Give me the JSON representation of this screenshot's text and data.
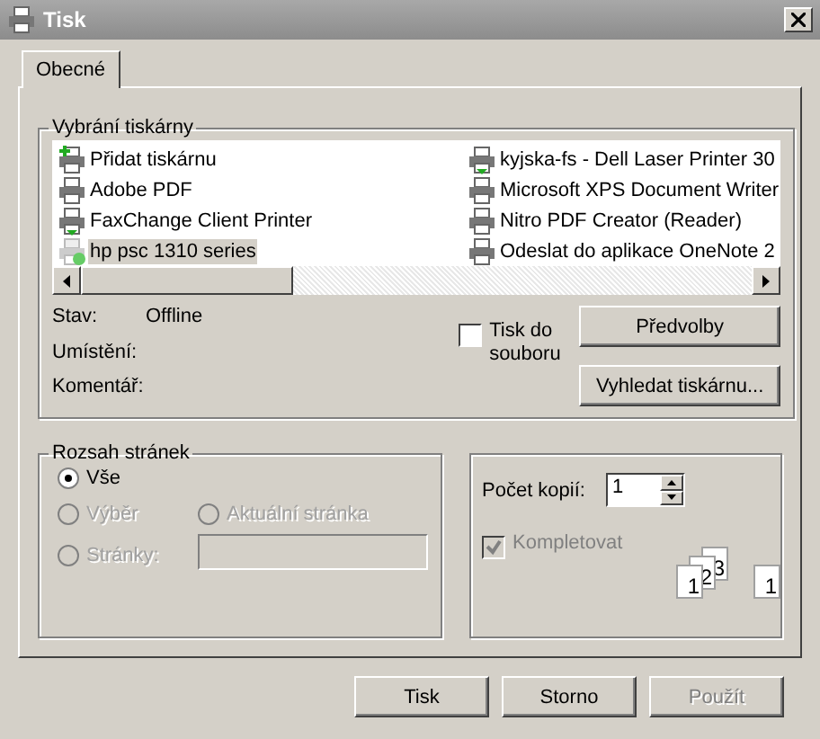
{
  "window": {
    "title": "Tisk"
  },
  "tabs": [
    {
      "label": "Obecné",
      "selected": true
    }
  ],
  "printer_group": {
    "title": "Vybrání tiskárny",
    "printers": [
      {
        "name": "Přidat tiskárnu",
        "kind": "add",
        "selected": false
      },
      {
        "name": "Adobe PDF",
        "kind": "printer",
        "selected": false
      },
      {
        "name": "FaxChange Client Printer",
        "kind": "network",
        "selected": false
      },
      {
        "name": "hp psc 1310 series",
        "kind": "default",
        "selected": true
      },
      {
        "name": "kyjska-fs - Dell Laser Printer 30",
        "kind": "network",
        "selected": false
      },
      {
        "name": "Microsoft XPS Document Writer",
        "kind": "printer",
        "selected": false
      },
      {
        "name": "Nitro PDF Creator (Reader)",
        "kind": "printer",
        "selected": false
      },
      {
        "name": "Odeslat do aplikace OneNote 2",
        "kind": "printer",
        "selected": false
      }
    ],
    "info": [
      {
        "label": "Stav:",
        "value": "Offline"
      },
      {
        "label": "Umístění:"
      },
      {
        "label": "Komentář:"
      }
    ],
    "print_to_file": {
      "label": "Tisk do souboru",
      "checked": false
    },
    "buttons": [
      "Předvolby",
      "Vyhledat tiskárnu..."
    ]
  },
  "range_group": {
    "title": "Rozsah stránek",
    "options": [
      {
        "label": "Vše",
        "selected": true,
        "disabled": false
      },
      {
        "label": "Výběr",
        "selected": false,
        "disabled": true
      },
      {
        "label": "Aktuální stránka",
        "selected": false,
        "disabled": true
      },
      {
        "label": "Stránky:",
        "selected": false,
        "disabled": true
      }
    ]
  },
  "copies_group": {
    "label": "Počet kopií:",
    "value": "1",
    "collate": {
      "label": "Kompletovat",
      "checked": true,
      "disabled": true
    },
    "collate_sheets": [
      "1",
      "2",
      "3",
      "1"
    ]
  },
  "buttons": [
    {
      "label": "Tisk",
      "disabled": false
    },
    {
      "label": "Storno",
      "disabled": false
    },
    {
      "label": "Použít",
      "disabled": true
    }
  ]
}
